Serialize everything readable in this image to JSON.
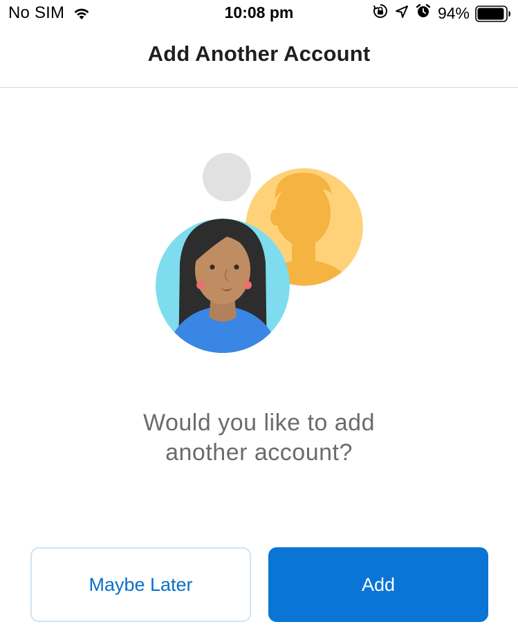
{
  "status_bar": {
    "carrier": "No SIM",
    "time": "10:08 pm",
    "battery_percent": "94%",
    "battery_level": 0.94,
    "icons": [
      "wifi-icon",
      "orientation-lock-icon",
      "location-arrow-icon",
      "alarm-clock-icon",
      "battery-icon"
    ]
  },
  "header": {
    "title": "Add Another Account"
  },
  "main": {
    "prompt_line1": "Would you like to add",
    "prompt_line2": "another account?"
  },
  "actions": {
    "maybe_later_label": "Maybe Later",
    "add_label": "Add"
  },
  "colors": {
    "accent": "#0a75d4",
    "link_text": "#0a6fc8",
    "secondary_border": "#cfe3f2",
    "prompt_text": "#6b6b6b",
    "avatar_woman_bg": "#7fdcef",
    "avatar_man_bg": "#ffd27a",
    "placeholder_circle": "#e1e1e1"
  }
}
